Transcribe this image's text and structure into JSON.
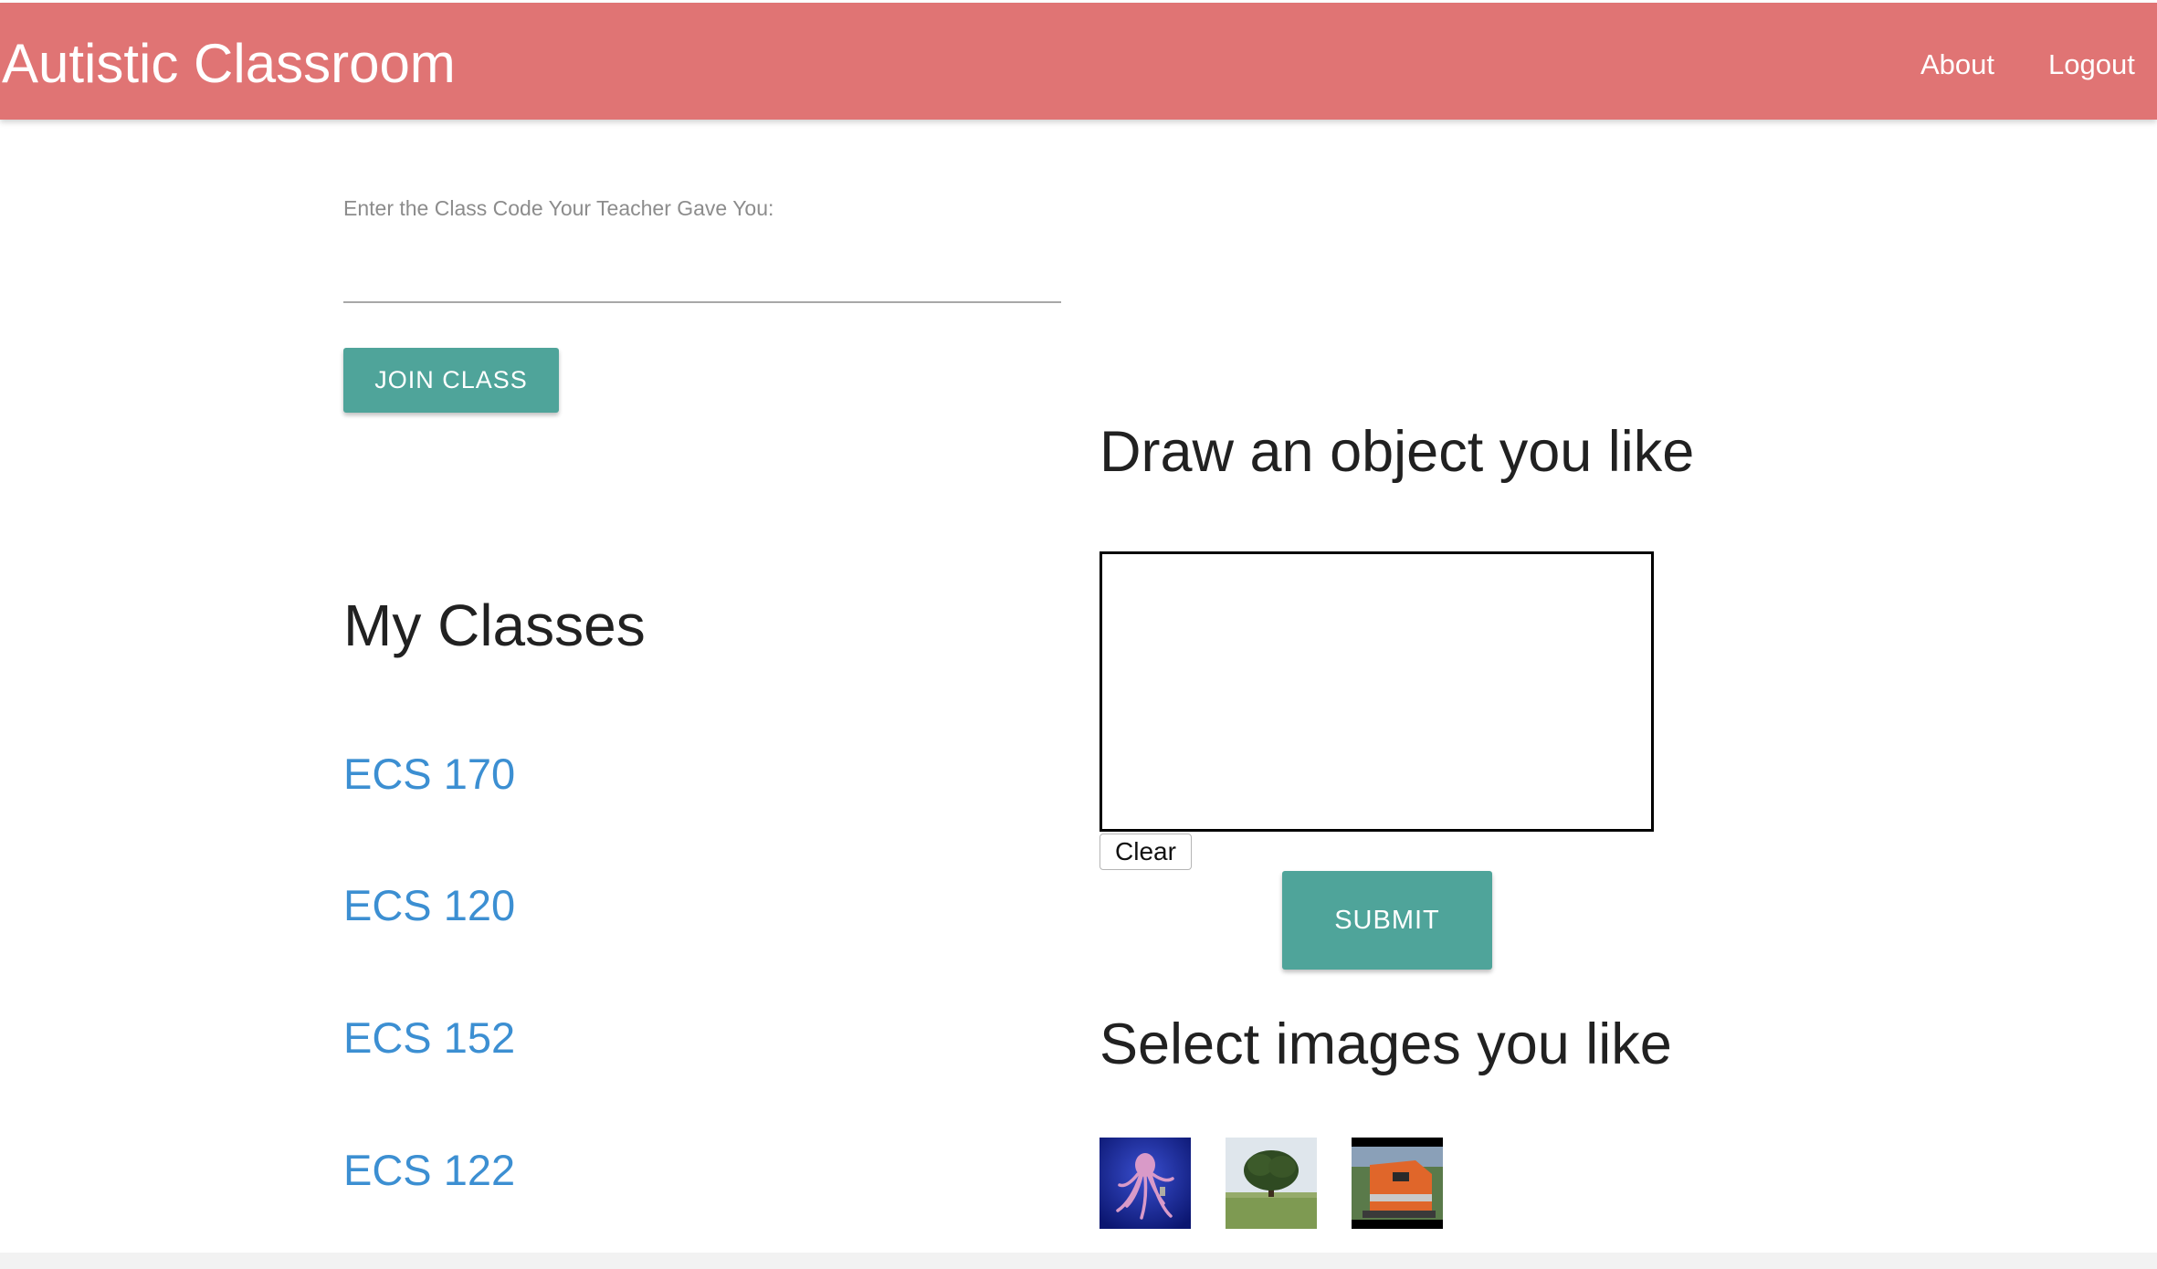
{
  "navbar": {
    "brand": "Autistic Classroom",
    "links": [
      {
        "label": "About"
      },
      {
        "label": "Logout"
      }
    ],
    "color": "#e07474"
  },
  "join": {
    "label": "Enter the Class Code Your Teacher Gave You:",
    "input_value": "",
    "button_label": "JOIN CLASS"
  },
  "classes": {
    "title": "My Classes",
    "items": [
      {
        "label": "ECS 170"
      },
      {
        "label": "ECS 120"
      },
      {
        "label": "ECS 152"
      },
      {
        "label": "ECS 122"
      }
    ],
    "link_color": "#3c8fd2"
  },
  "draw": {
    "title": "Draw an object you like",
    "clear_label": "Clear",
    "submit_label": "SUBMIT"
  },
  "select": {
    "title": "Select images you like",
    "images": [
      {
        "icon": "octopus-image"
      },
      {
        "icon": "tree-image"
      },
      {
        "icon": "train-image"
      }
    ]
  },
  "accent_color": "#4fa49a"
}
